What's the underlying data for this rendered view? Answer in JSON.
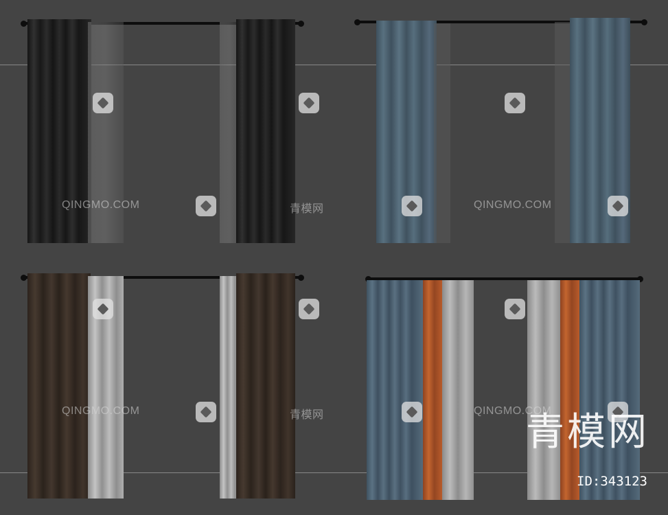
{
  "scene": {
    "background": "#444444",
    "watermark": {
      "brand_text": "QINGMO.COM",
      "cn_text": "青模网",
      "big_text": "青模网",
      "id_label": "ID:343123"
    },
    "variants": [
      {
        "name_icon": "curtain-set-black",
        "main_color": "#1e1e1e",
        "sheer_color": "#6e6e6e"
      },
      {
        "name_icon": "curtain-set-blue",
        "main_color": "#4b5f6e",
        "sheer_color": "#5a5a5a"
      },
      {
        "name_icon": "curtain-set-brown",
        "main_color": "#3a2f28",
        "sheer_color": "#a9a9a9"
      },
      {
        "name_icon": "curtain-set-blue-orange",
        "main_color": "#4d6070",
        "sheer_color": "#9e9e9e",
        "accent_color": "#b2582a"
      }
    ]
  }
}
